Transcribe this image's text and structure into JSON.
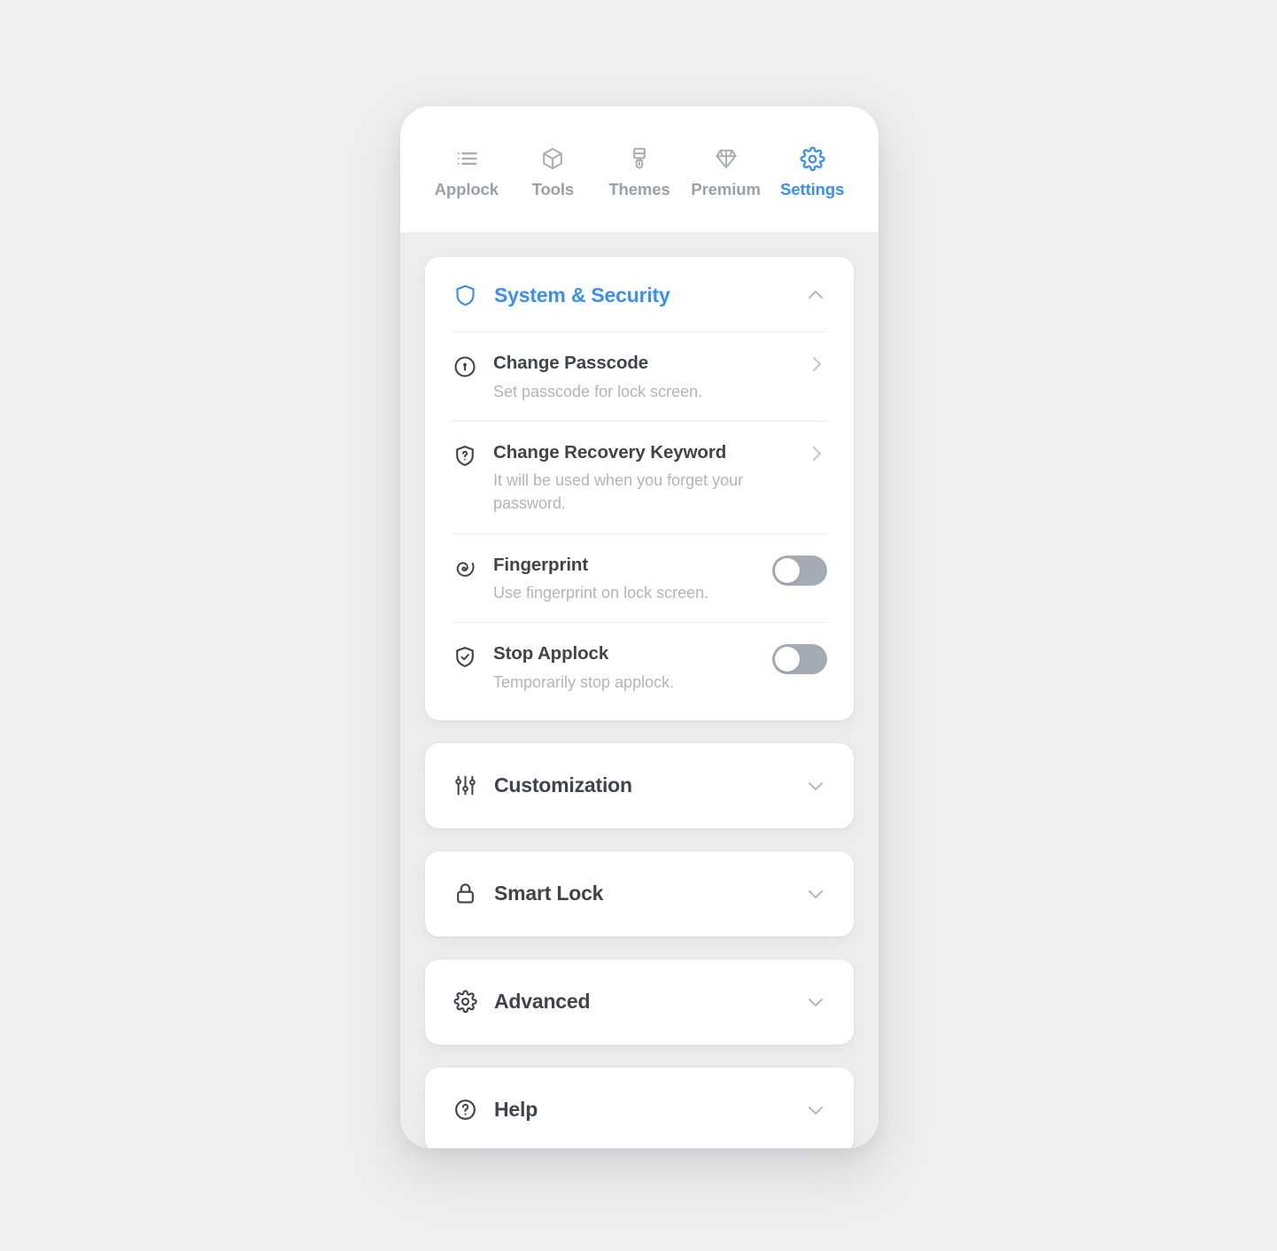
{
  "theme": {
    "accent": "#3b8fef",
    "page_background": "#efefef",
    "screen_background": "#eceded",
    "card_background": "#ffffff",
    "title_color": "#3f444b",
    "subtitle_color": "#b0b5bc",
    "toggle_off_track": "#a5abb5"
  },
  "tabbar": {
    "tabs": [
      {
        "id": "applock",
        "label": "Applock",
        "icon": "list-icon",
        "active": false
      },
      {
        "id": "tools",
        "label": "Tools",
        "icon": "cube-icon",
        "active": false
      },
      {
        "id": "themes",
        "label": "Themes",
        "icon": "brush-icon",
        "active": false
      },
      {
        "id": "premium",
        "label": "Premium",
        "icon": "diamond-icon",
        "active": false
      },
      {
        "id": "settings",
        "label": "Settings",
        "icon": "gear-icon",
        "active": true
      }
    ]
  },
  "sections": {
    "system_security": {
      "title": "System & Security",
      "icon": "shield-icon",
      "expanded": true,
      "chevron": "chevron-up-icon",
      "rows": [
        {
          "id": "change-passcode",
          "title": "Change Passcode",
          "subtitle": "Set passcode for lock screen.",
          "icon": "keyhole-circle-icon",
          "action": "chevron-right-icon"
        },
        {
          "id": "change-recovery-keyword",
          "title": "Change Recovery Keyword",
          "subtitle": "It will be used when you forget your password.",
          "icon": "shield-question-icon",
          "action": "chevron-right-icon"
        },
        {
          "id": "fingerprint",
          "title": "Fingerprint",
          "subtitle": "Use fingerprint on lock screen.",
          "icon": "fingerprint-spiral-icon",
          "action": "toggle",
          "toggle_state": "off"
        },
        {
          "id": "stop-applock",
          "title": "Stop Applock",
          "subtitle": "Temporarily stop applock.",
          "icon": "shield-check-icon",
          "action": "toggle",
          "toggle_state": "off"
        }
      ]
    },
    "customization": {
      "title": "Customization",
      "icon": "sliders-icon",
      "expanded": false,
      "chevron": "chevron-down-icon"
    },
    "smart_lock": {
      "title": "Smart Lock",
      "icon": "padlock-icon",
      "expanded": false,
      "chevron": "chevron-down-icon"
    },
    "advanced": {
      "title": "Advanced",
      "icon": "gear-icon",
      "expanded": false,
      "chevron": "chevron-down-icon"
    },
    "help": {
      "title": "Help",
      "icon": "question-circle-icon",
      "expanded": false,
      "chevron": "chevron-down-icon"
    }
  }
}
